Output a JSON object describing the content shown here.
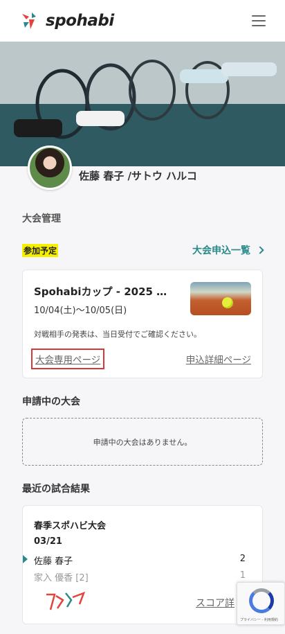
{
  "header": {
    "brand": "spohabi",
    "menu_icon": "hamburger-menu-icon"
  },
  "profile": {
    "name": "佐藤 春子 /サトウ ハルコ"
  },
  "tournament_management": {
    "title": "大会管理",
    "upcoming_badge": "参加予定",
    "list_link": "大会申込一覧"
  },
  "event_card": {
    "title": "Spohabiカップ - 2025 …",
    "dates": "10/04(土)〜10/05(日)",
    "note": "対戦相手の発表は、当日受付でご確認ください。",
    "event_page_link": "大会専用ページ",
    "application_detail_link": "申込詳細ページ"
  },
  "pending": {
    "title": "申請中の大会",
    "empty_message": "申請中の大会はありません。"
  },
  "recent_results": {
    "title": "最近の試合結果",
    "tournament": "春季スポハビ大会",
    "date": "03/21",
    "rows": [
      {
        "player": "佐藤 春子",
        "score": "2"
      },
      {
        "player": "家入 優香 [2]",
        "score": "1"
      }
    ],
    "score_link": "スコア詳"
  },
  "recaptcha": {
    "text": "プライバシー - 利用規約"
  },
  "colors": {
    "accent": "#2a8a8a",
    "highlight": "#f5f000",
    "focus_border": "#d23a3a"
  }
}
